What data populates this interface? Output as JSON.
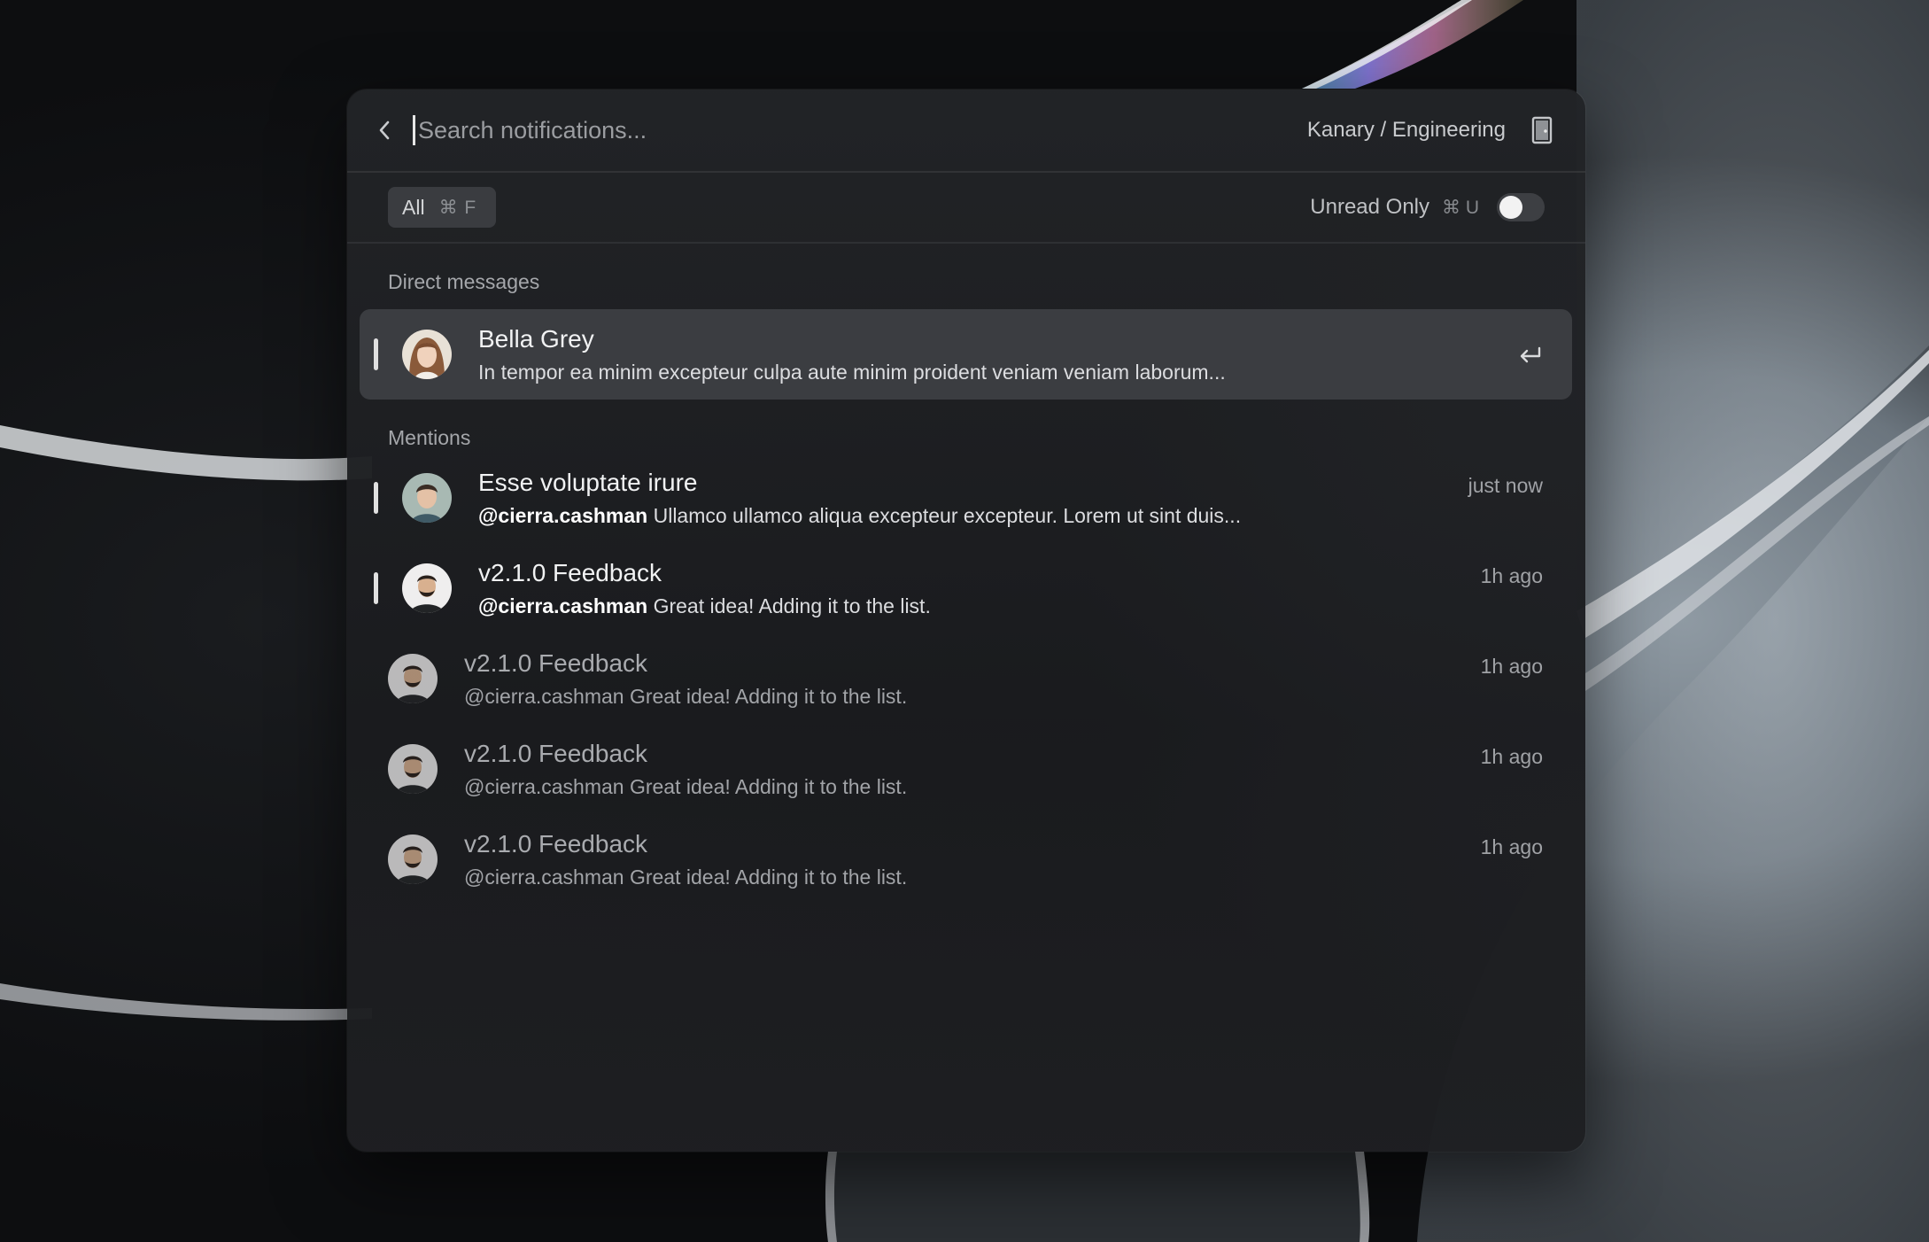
{
  "search": {
    "placeholder": "Search notifications...",
    "workspace": "Kanary / Engineering"
  },
  "filters": {
    "all_label": "All",
    "all_shortcut": "⌘ F",
    "unread_label": "Unread Only",
    "unread_shortcut": "⌘ U",
    "unread_enabled": false
  },
  "sections": {
    "direct_messages": "Direct messages",
    "mentions": "Mentions"
  },
  "direct_messages": [
    {
      "name": "Bella Grey",
      "message": "In tempor ea minim excepteur culpa aute minim proident veniam veniam laborum...",
      "unread": true,
      "selected": true
    }
  ],
  "mentions": [
    {
      "title": "Esse voluptate irure",
      "handle": "@cierra.cashman",
      "message": "Ullamco ullamco aliqua excepteur excepteur. Lorem ut sint duis...",
      "time": "just now",
      "unread": true
    },
    {
      "title": "v2.1.0 Feedback",
      "handle": "@cierra.cashman",
      "message": "Great idea! Adding it to the list.",
      "time": "1h ago",
      "unread": true
    },
    {
      "title": "v2.1.0 Feedback",
      "handle": "@cierra.cashman",
      "message": "Great idea! Adding it to the list.",
      "time": "1h ago",
      "unread": false
    },
    {
      "title": "v2.1.0 Feedback",
      "handle": "@cierra.cashman",
      "message": "Great idea! Adding it to the list.",
      "time": "1h ago",
      "unread": false
    },
    {
      "title": "v2.1.0 Feedback",
      "handle": "@cierra.cashman",
      "message": "Great idea! Adding it to the list.",
      "time": "1h ago",
      "unread": false
    }
  ],
  "colors": {
    "panel_bg": "#1f2023",
    "selected_row": "#3b3d41",
    "unread_indicator": "#e0e0e0"
  },
  "icons": {
    "back": "chevron-left-icon",
    "workspace": "door-icon",
    "enter": "enter-return-icon"
  }
}
